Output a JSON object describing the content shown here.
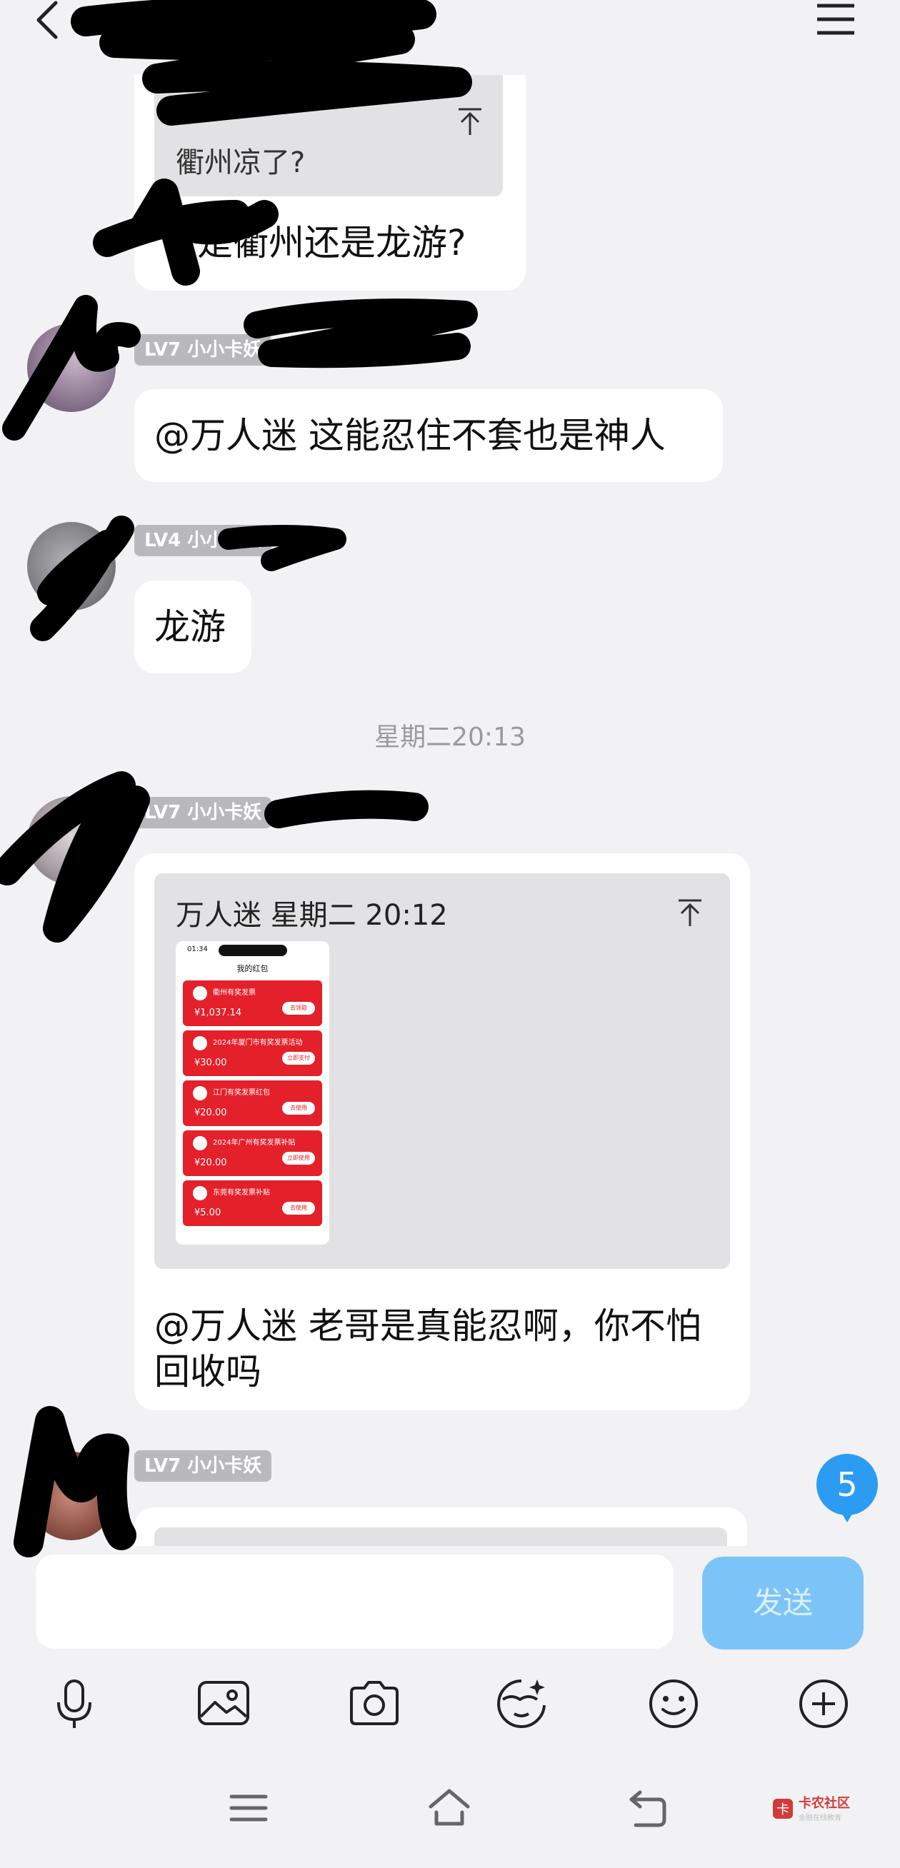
{
  "header": {
    "title": ""
  },
  "messages": [
    {
      "quote": {
        "text": "衢州凉了?"
      },
      "text": "是衢州还是龙游?"
    },
    {
      "sender": {
        "level_tag": "LV7 小小卡妖"
      },
      "text": "@万人迷 这能忍住不套也是神人"
    },
    {
      "sender": {
        "level_tag": "LV4 小小卡妖"
      },
      "text": "龙游"
    },
    {
      "timestamp": "星期二20:13"
    },
    {
      "sender": {
        "level_tag": "LV7 小小卡妖"
      },
      "quote": {
        "header": "万人迷 星期二 20:12",
        "image": {
          "status_time": "01:34",
          "title": "我的红包",
          "packets": [
            {
              "name": "衢州有奖发票",
              "amount": "¥1,037.14",
              "button": "去领取"
            },
            {
              "name": "2024年厦门市有奖发票活动",
              "amount": "¥30.00",
              "button": "立即支付"
            },
            {
              "name": "江门有奖发票红包",
              "amount": "¥20.00",
              "button": "去使用"
            },
            {
              "name": "2024年广州有奖发票补贴",
              "amount": "¥20.00",
              "button": "立即使用"
            },
            {
              "name": "东莞有奖发票补贴",
              "amount": "¥5.00",
              "button": "去使用"
            }
          ]
        }
      },
      "text": "@万人迷 老哥是真能忍啊，你不怕\n回收吗"
    },
    {
      "sender": {
        "level_tag": "LV7 小小卡妖"
      }
    }
  ],
  "unread_badge": "5",
  "composer": {
    "input_value": "",
    "send_label": "发送"
  },
  "toolbar": {
    "icons": [
      "microphone-icon",
      "image-icon",
      "camera-icon",
      "sticker-icon",
      "emoji-icon",
      "plus-circle-icon"
    ]
  },
  "system_nav": {
    "icons": [
      "menu-icon",
      "home-icon",
      "back-icon"
    ]
  },
  "watermark": {
    "name": "卡农社区",
    "tagline": "金融在线教育"
  },
  "colors": {
    "background": "#f2f2f4",
    "bubble": "#ffffff",
    "quote": "#e2e2e4",
    "level_tag": "#b9b9bd",
    "send_button": "#7cc4f8",
    "badge": "#2b9cf2",
    "red_packet": "#e4202a"
  }
}
